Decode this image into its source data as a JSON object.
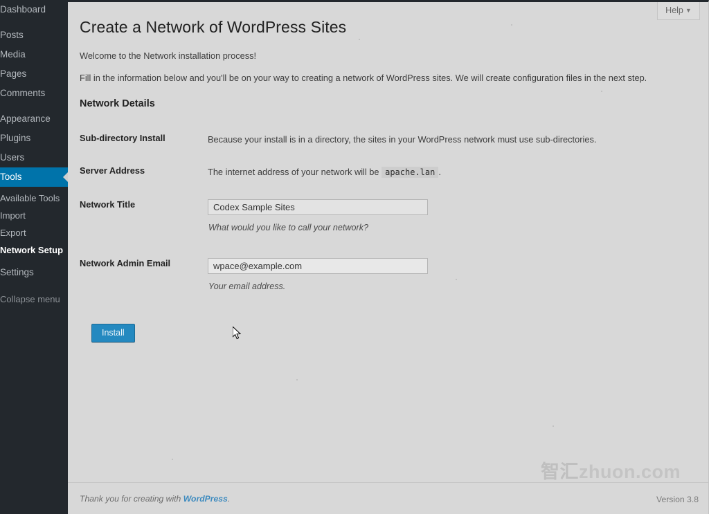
{
  "sidebar": {
    "items": [
      {
        "label": "Dashboard",
        "id": "dashboard",
        "current": false
      },
      {
        "label": "Posts",
        "id": "posts",
        "current": false
      },
      {
        "label": "Media",
        "id": "media",
        "current": false
      },
      {
        "label": "Pages",
        "id": "pages",
        "current": false
      },
      {
        "label": "Comments",
        "id": "comments",
        "current": false
      },
      {
        "label": "Appearance",
        "id": "appearance",
        "current": false
      },
      {
        "label": "Plugins",
        "id": "plugins",
        "current": false
      },
      {
        "label": "Users",
        "id": "users",
        "current": false
      },
      {
        "label": "Tools",
        "id": "tools",
        "current": true
      },
      {
        "label": "Settings",
        "id": "settings",
        "current": false
      }
    ],
    "submenu": [
      {
        "label": "Available Tools",
        "id": "available-tools",
        "current": false
      },
      {
        "label": "Import",
        "id": "import",
        "current": false
      },
      {
        "label": "Export",
        "id": "export",
        "current": false
      },
      {
        "label": "Network Setup",
        "id": "network-setup",
        "current": true
      }
    ],
    "collapse_label": "Collapse menu",
    "highlight_color": "#0073aa"
  },
  "help": {
    "label": "Help",
    "chevron": "▼"
  },
  "page": {
    "title": "Create a Network of WordPress Sites",
    "intro_1": "Welcome to the Network installation process!",
    "intro_2": "Fill in the information below and you'll be on your way to creating a network of WordPress sites. We will create configuration files in the next step.",
    "section_title": "Network Details"
  },
  "form": {
    "subdirectory": {
      "label": "Sub-directory Install",
      "description": "Because your install is in a directory, the sites in your WordPress network must use sub-directories."
    },
    "server_address": {
      "label": "Server Address",
      "description_before": "The internet address of your network will be",
      "address": "apache.lan",
      "description_after": "."
    },
    "network_title": {
      "label": "Network Title",
      "value": "Codex Sample Sites",
      "placeholder": "",
      "hint": "What would you like to call your network?"
    },
    "admin_email": {
      "label": "Network Admin Email",
      "value": "wpace@example.com",
      "placeholder": "",
      "hint": "Your email address."
    },
    "submit_label": "Install"
  },
  "footer": {
    "thanks_before": "Thank you for creating with ",
    "thanks_link": "WordPress",
    "thanks_after": ".",
    "version": "Version 3.8"
  },
  "watermark": {
    "cjk": "智汇",
    "latin": "zhuon.com"
  }
}
